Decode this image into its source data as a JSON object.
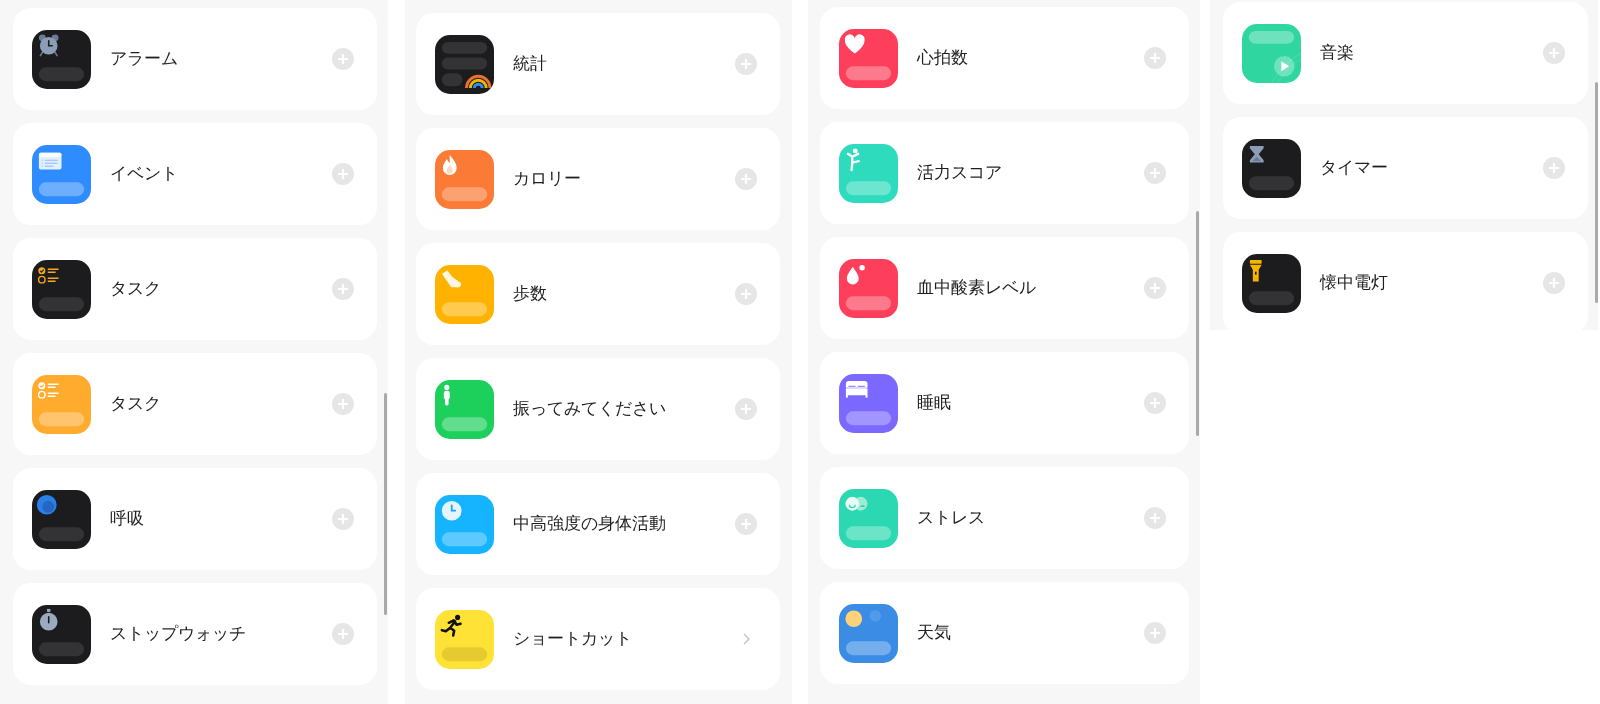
{
  "panels": [
    {
      "items": [
        {
          "kind": "alarm",
          "label": "アラーム",
          "color": "#1c1c1e",
          "trailing": {
            "kind": "add"
          }
        },
        {
          "kind": "event",
          "label": "イベント",
          "color": "#2f8cff",
          "trailing": {
            "kind": "add"
          }
        },
        {
          "kind": "task",
          "label": "タスク",
          "color": "#1c1c1e",
          "trailing": {
            "kind": "add"
          }
        },
        {
          "kind": "task",
          "label": "タスク",
          "color": "#ffab2e",
          "trailing": {
            "kind": "add"
          }
        },
        {
          "kind": "breath",
          "label": "呼吸",
          "color": "#1c1c1e",
          "trailing": {
            "kind": "add"
          }
        },
        {
          "kind": "stopwatch",
          "label": "ストップウォッチ",
          "color": "#1c1c1e",
          "trailing": {
            "kind": "add"
          }
        }
      ]
    },
    {
      "items": [
        {
          "kind": "stats",
          "label": "統計",
          "color": "#1c1c1e",
          "trailing": {
            "kind": "add"
          }
        },
        {
          "kind": "calories",
          "label": "カロリー",
          "color": "#fb7a35",
          "trailing": {
            "kind": "add"
          }
        },
        {
          "kind": "steps",
          "label": "歩数",
          "color": "#ffb300",
          "trailing": {
            "kind": "add"
          }
        },
        {
          "kind": "shake",
          "label": "振ってみてください",
          "color": "#1dd05c",
          "trailing": {
            "kind": "add"
          }
        },
        {
          "kind": "activity",
          "label": "中高強度の身体活動",
          "color": "#16b4ff",
          "trailing": {
            "kind": "add"
          }
        },
        {
          "kind": "shortcut",
          "label": "ショートカット",
          "color": "#ffe235",
          "trailing": {
            "kind": "chevron"
          }
        }
      ]
    },
    {
      "items": [
        {
          "kind": "heart",
          "label": "心拍数",
          "color": "#fd3f5b",
          "trailing": {
            "kind": "add"
          }
        },
        {
          "kind": "vitality",
          "label": "活力スコア",
          "color": "#2edbbd",
          "trailing": {
            "kind": "add"
          }
        },
        {
          "kind": "oxygen",
          "label": "血中酸素レベル",
          "color": "#fd3f5b",
          "trailing": {
            "kind": "add"
          }
        },
        {
          "kind": "sleep",
          "label": "睡眠",
          "color": "#7b68ff",
          "trailing": {
            "kind": "add"
          }
        },
        {
          "kind": "stress",
          "label": "ストレス",
          "color": "#2bd8b1",
          "trailing": {
            "kind": "add"
          }
        },
        {
          "kind": "weather",
          "label": "天気",
          "color": "#3a8ce4",
          "trailing": {
            "kind": "add"
          }
        }
      ]
    },
    {
      "items": [
        {
          "kind": "music",
          "label": "音楽",
          "color": "#30d6a0",
          "trailing": {
            "kind": "add"
          }
        },
        {
          "kind": "timer",
          "label": "タイマー",
          "color": "#1c1c1e",
          "trailing": {
            "kind": "add"
          }
        },
        {
          "kind": "flashlight",
          "label": "懐中電灯",
          "color": "#1c1c1e",
          "trailing": {
            "kind": "add"
          }
        }
      ]
    }
  ]
}
